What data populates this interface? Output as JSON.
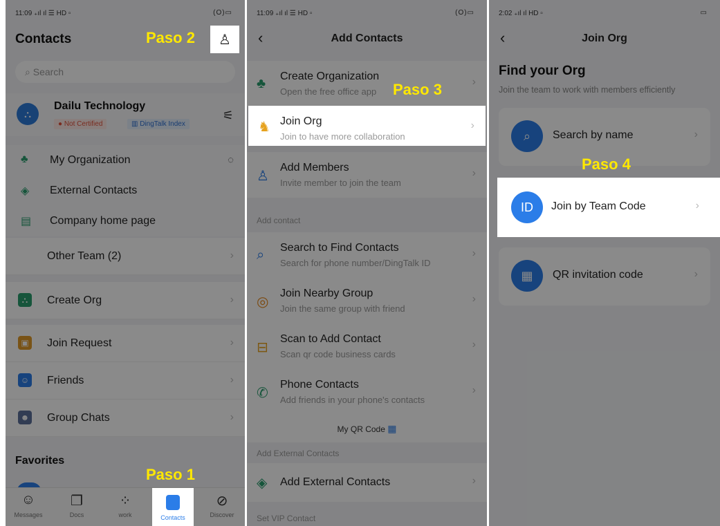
{
  "colors": {
    "accent": "#2b7de8",
    "highlight": "#ffe800",
    "overlay": "rgba(0,0,0,0.46)"
  },
  "steps": {
    "step1": "Paso 1",
    "step2": "Paso 2",
    "step3": "Paso 3",
    "step4": "Paso 4"
  },
  "panel1": {
    "status_time": "11:09",
    "status_icons": "(O)▭",
    "title": "Contacts",
    "add_contact_icon": "add-person-icon",
    "search_placeholder": "Search",
    "org": {
      "name": "Dailu Technology",
      "badge_cert": "Not Certified",
      "badge_index": "DingTalk Index"
    },
    "org_links": [
      {
        "label": "My Organization",
        "icon": "org-tree-icon"
      },
      {
        "label": "External Contacts",
        "icon": "handshake-icon"
      },
      {
        "label": "Company home page",
        "icon": "page-icon"
      }
    ],
    "other_team": "Other Team (2)",
    "create_org": "Create Org",
    "menu": [
      {
        "label": "Join Request",
        "icon": "request-icon"
      },
      {
        "label": "Friends",
        "icon": "friend-icon"
      },
      {
        "label": "Group Chats",
        "icon": "group-icon"
      }
    ],
    "favorites": "Favorites",
    "tabs": [
      {
        "label": "Messages",
        "icon": "chat-icon"
      },
      {
        "label": "Docs",
        "icon": "docs-icon"
      },
      {
        "label": "work",
        "icon": "grid-icon"
      },
      {
        "label": "Contacts",
        "icon": "contacts-icon"
      },
      {
        "label": "Discover",
        "icon": "compass-icon"
      }
    ]
  },
  "panel2": {
    "status_time": "11:09",
    "status_icons": "(O)▭",
    "title": "Add Contacts",
    "items_top": [
      {
        "title": "Create Organization",
        "sub": "Open the free office app"
      },
      {
        "title": "Join Org",
        "sub": "Join to have more collaboration"
      },
      {
        "title": "Add Members",
        "sub": "Invite member to join the team"
      }
    ],
    "section_add_contact": "Add contact",
    "items_contact": [
      {
        "title": "Search to Find Contacts",
        "sub": "Search for phone number/DingTalk ID"
      },
      {
        "title": "Join Nearby Group",
        "sub": "Join the same group with friend"
      },
      {
        "title": "Scan to Add Contact",
        "sub": "Scan qr code business cards"
      },
      {
        "title": "Phone Contacts",
        "sub": "Add friends in your phone's contacts"
      }
    ],
    "qr_code": "My QR Code",
    "section_external": "Add External Contacts",
    "add_external": "Add External Contacts",
    "section_vip": "Set VIP Contact"
  },
  "panel3": {
    "status_time": "2:02",
    "title": "Join Org",
    "find_title": "Find your Org",
    "find_sub": "Join the team to work with members efficiently",
    "options": [
      {
        "label": "Search by name",
        "badge": ""
      },
      {
        "label": "Join by Team Code",
        "badge": "ID"
      },
      {
        "label": "QR invitation code",
        "badge": ""
      }
    ]
  }
}
